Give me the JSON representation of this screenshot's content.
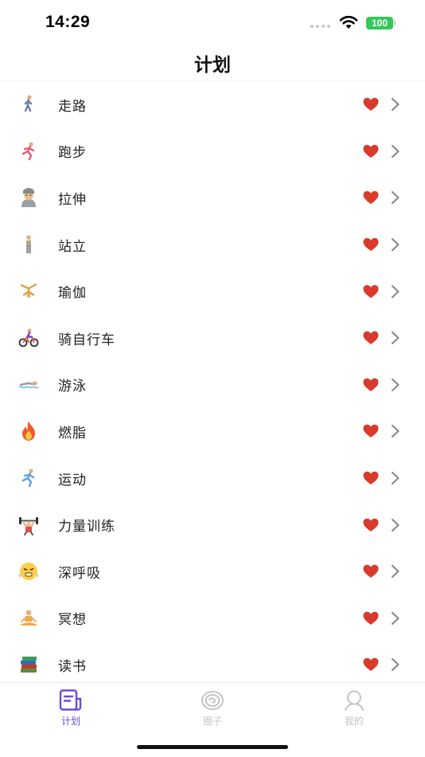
{
  "status_bar": {
    "time": "14:29",
    "battery": "100"
  },
  "header": {
    "title": "计划"
  },
  "plans": [
    {
      "icon": "walking-person-icon",
      "label": "走路"
    },
    {
      "icon": "running-person-icon",
      "label": "跑步"
    },
    {
      "icon": "stretching-person-icon",
      "label": "拉伸"
    },
    {
      "icon": "standing-person-icon",
      "label": "站立"
    },
    {
      "icon": "cartwheel-person-icon",
      "label": "瑜伽"
    },
    {
      "icon": "cyclist-icon",
      "label": "骑自行车"
    },
    {
      "icon": "swimmer-icon",
      "label": "游泳"
    },
    {
      "icon": "fire-icon",
      "label": "燃脂"
    },
    {
      "icon": "running-person-icon",
      "label": "运动"
    },
    {
      "icon": "weightlifter-icon",
      "label": "力量训练"
    },
    {
      "icon": "steaming-face-icon",
      "label": "深呼吸"
    },
    {
      "icon": "meditation-person-icon",
      "label": "冥想"
    },
    {
      "icon": "books-icon",
      "label": "读书"
    }
  ],
  "tabs": [
    {
      "label": "计划",
      "icon": "plan-document-icon",
      "active": true
    },
    {
      "label": "圈子",
      "icon": "circle-swirl-icon",
      "active": false
    },
    {
      "label": "我的",
      "icon": "profile-icon",
      "active": false
    }
  ],
  "colors": {
    "heart": "#d93a2b",
    "tab_active": "#6a4bd9",
    "tab_inactive": "#c4c4c4",
    "battery": "#34c759"
  }
}
